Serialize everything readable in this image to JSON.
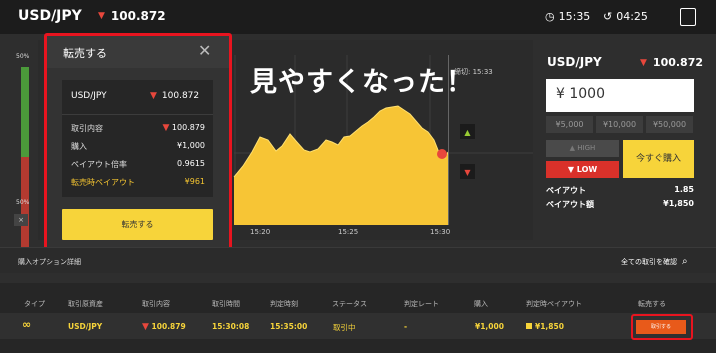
{
  "topbar": {
    "symbol": "USD/JPY",
    "price": "100.872",
    "clock": "15:35",
    "timer": "04:25"
  },
  "leftbar": {
    "top_pct": "50%",
    "bottom_pct": "50%",
    "close": "×"
  },
  "chart": {
    "note": "締切: 15:33",
    "x_ticks": [
      "15:20",
      "15:25",
      "15:30"
    ],
    "overlay_text": "見やすくなった！"
  },
  "modal": {
    "title": "転売する",
    "close": "✕",
    "symbol": "USD/JPY",
    "symbol_price": "100.872",
    "rows": [
      {
        "label": "取引内容",
        "value": "100.879"
      },
      {
        "label": "購入",
        "value": "¥1,000"
      },
      {
        "label": "ペイアウト倍率",
        "value": "0.9615"
      },
      {
        "label": "転売時ペイアウト",
        "value": "¥961"
      }
    ],
    "button": "転売する"
  },
  "right_panel": {
    "symbol": "USD/JPY",
    "price": "100.872",
    "amount": "¥ 1000",
    "presets": [
      "¥5,000",
      "¥10,000",
      "¥50,000"
    ],
    "high": "HIGH",
    "low": "LOW",
    "buy": "今すぐ購入",
    "payout_label": "ペイアウト",
    "payout_value": "1.85",
    "payout_amount_label": "ペイアウト額",
    "payout_amount_value": "¥1,850"
  },
  "section": {
    "title": "購入オプション詳細",
    "link": "全ての取引を確認"
  },
  "table": {
    "headers": [
      "タイプ",
      "取引原資産",
      "取引内容",
      "取引時間",
      "判定時刻",
      "ステータス",
      "判定レート",
      "購入",
      "判定時ペイアウト",
      "転売する"
    ],
    "row": {
      "asset": "USD/JPY",
      "content": "100.879",
      "time": "15:30:08",
      "judge_time": "15:35:00",
      "status": "取引中",
      "rate": "-",
      "buy": "¥1,000",
      "payout": "¥1,850",
      "sell": "取引する"
    }
  },
  "colors": {
    "accent": "#f7d43a",
    "down": "#e8473c",
    "highlight": "#e8141f"
  }
}
